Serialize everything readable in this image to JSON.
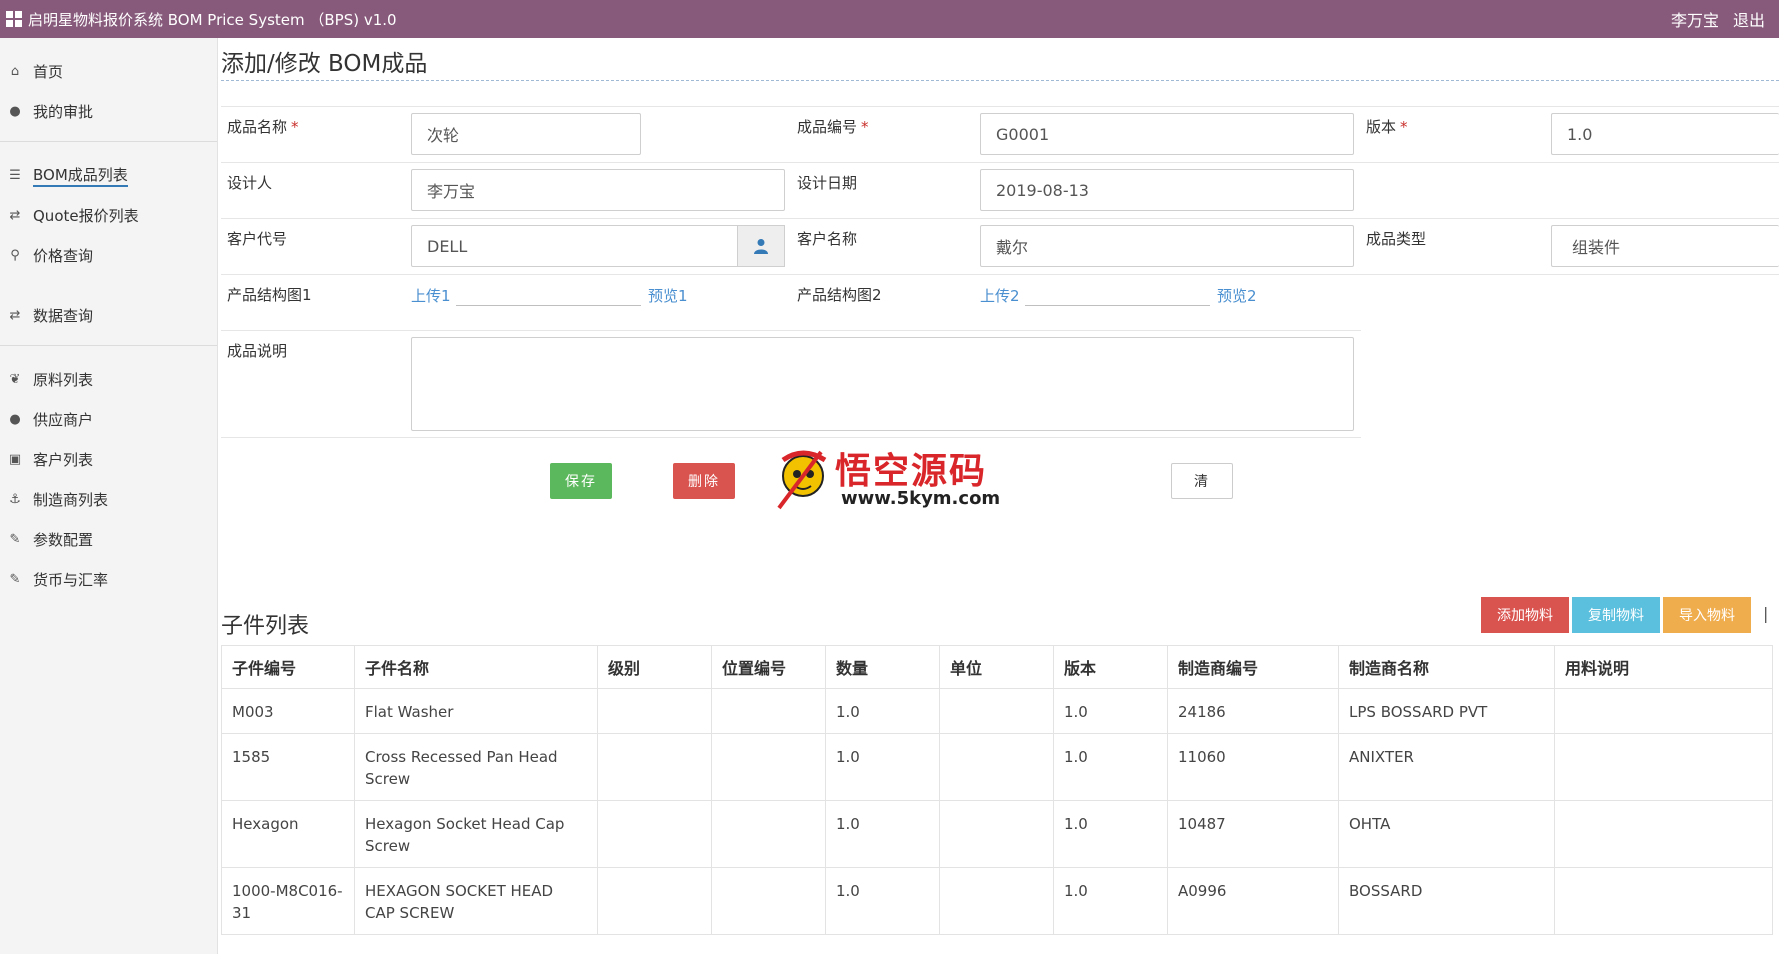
{
  "header": {
    "app_title": "启明星物料报价系统 BOM Price System （BPS) v1.0",
    "user": "李万宝",
    "logout": "退出"
  },
  "sidebar": {
    "items": [
      {
        "label": "首页",
        "icon": "home-icon"
      },
      {
        "label": "我的审批",
        "icon": "comment-icon"
      },
      {
        "label": "BOM成品列表",
        "icon": "list-icon",
        "active": true
      },
      {
        "label": "Quote报价列表",
        "icon": "retweet-icon"
      },
      {
        "label": "价格查询",
        "icon": "search-icon"
      },
      {
        "label": "数据查询",
        "icon": "retweet-icon"
      },
      {
        "label": "原料列表",
        "icon": "leaf-icon"
      },
      {
        "label": "供应商户",
        "icon": "user-icon"
      },
      {
        "label": "客户列表",
        "icon": "contact-icon"
      },
      {
        "label": "制造商列表",
        "icon": "anchor-icon"
      },
      {
        "label": "参数配置",
        "icon": "wrench-icon"
      },
      {
        "label": "货币与汇率",
        "icon": "wrench-icon"
      }
    ]
  },
  "page": {
    "title": "添加/修改 BOM成品"
  },
  "form": {
    "product_name_label": "成品名称",
    "product_name": "次轮",
    "product_code_label": "成品编号",
    "product_code": "G0001",
    "version_label": "版本",
    "version": "1.0",
    "designer_label": "设计人",
    "designer": "李万宝",
    "design_date_label": "设计日期",
    "design_date": "2019-08-13",
    "customer_code_label": "客户代号",
    "customer_code": "DELL",
    "customer_name_label": "客户名称",
    "customer_name": "戴尔",
    "product_type_label": "成品类型",
    "product_type": "组装件",
    "structure1_label": "产品结构图1",
    "upload1": "上传1",
    "preview1": "预览1",
    "structure2_label": "产品结构图2",
    "upload2": "上传2",
    "preview2": "预览2",
    "description_label": "成品说明",
    "required_mark": "*"
  },
  "actions": {
    "save": "保存",
    "delete": "删除",
    "clear": "清"
  },
  "watermark": {
    "text": "悟空源码",
    "url": "www.5kym.com"
  },
  "subtable": {
    "title": "子件列表",
    "buttons": {
      "add": "添加物料",
      "copy": "复制物料",
      "import": "导入物料",
      "more": "|"
    },
    "columns": [
      "子件编号",
      "子件名称",
      "级别",
      "位置编号",
      "数量",
      "单位",
      "版本",
      "制造商编号",
      "制造商名称",
      "用料说明"
    ],
    "rows": [
      [
        "M003",
        "Flat Washer",
        "",
        "",
        "1.0",
        "",
        "1.0",
        "24186",
        "LPS BOSSARD PVT",
        ""
      ],
      [
        "1585",
        "Cross Recessed Pan Head Screw",
        "",
        "",
        "1.0",
        "",
        "1.0",
        "11060",
        "ANIXTER",
        ""
      ],
      [
        "Hexagon",
        "Hexagon Socket Head Cap Screw",
        "",
        "",
        "1.0",
        "",
        "1.0",
        "10487",
        "OHTA",
        ""
      ],
      [
        "1000-M8C016-31",
        "HEXAGON SOCKET HEAD CAP SCREW",
        "",
        "",
        "1.0",
        "",
        "1.0",
        "A0996",
        "BOSSARD",
        ""
      ]
    ]
  },
  "colors": {
    "header": "#875a7b",
    "save": "#5cb85c",
    "delete": "#d9534f",
    "add": "#d9534f",
    "copy": "#5bc0de",
    "import": "#f0ad4e",
    "link": "#4a8fd0"
  }
}
